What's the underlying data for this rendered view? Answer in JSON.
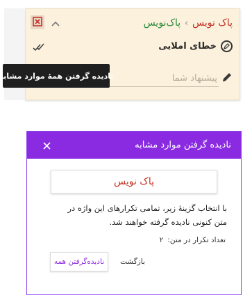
{
  "suggestion_card": {
    "breadcrumb": {
      "original_word": "پاک نویس",
      "separator": "›",
      "suggested_word": "پاک‌نویس"
    },
    "rule_label": "خطای املایی",
    "suggest_placeholder": "پیشنهاد شما",
    "tooltip": "نادیده گرفتن همهٔ موارد مشابه",
    "icons": [
      "ignore-icon",
      "chevron-up-icon",
      "check-circle-icon",
      "double-check-icon",
      "pencil-icon"
    ]
  },
  "dialog": {
    "title": "نادیده گرفتن موارد مشابه",
    "close_icon": "close-icon",
    "word": "پاک نویس",
    "description": "با انتخاب گزینهٔ زیر، تمامی تکرارهای این واژه در متن کنونی نادیده گرفته خواهند شد.",
    "count_label": "تعداد تکرار در متن:",
    "count_value": "۲",
    "ignore_all_label": "نادیده‌گرفتن همه",
    "back_label": "بازگشت"
  },
  "colors": {
    "accent_purple": "#8a2be2",
    "error_red": "#c43326",
    "success_green": "#2e8a3a",
    "card_bg": "#fbf1dd"
  }
}
